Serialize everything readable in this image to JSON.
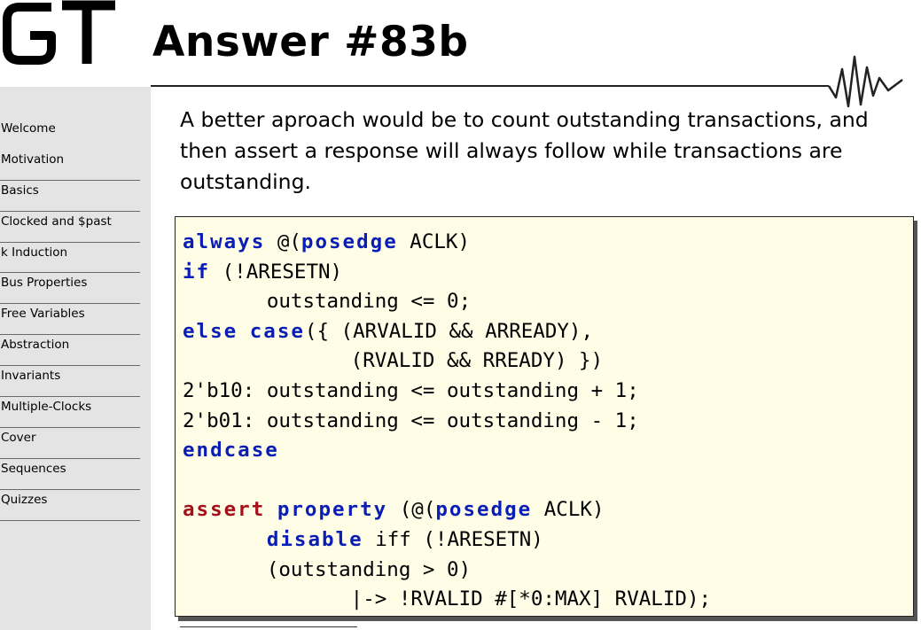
{
  "slide": {
    "logo_text": "GT",
    "title": "Answer #83b"
  },
  "sidebar": {
    "items": [
      {
        "label": "Welcome"
      },
      {
        "label": "Motivation"
      },
      {
        "label": "Basics"
      },
      {
        "label": "Clocked and $past"
      },
      {
        "label": "k Induction"
      },
      {
        "label": "Bus Properties"
      },
      {
        "label": "Free Variables"
      },
      {
        "label": "Abstraction"
      },
      {
        "label": "Invariants"
      },
      {
        "label": "Multiple-Clocks"
      },
      {
        "label": "Cover"
      },
      {
        "label": "Sequences"
      },
      {
        "label": "Quizzes"
      }
    ]
  },
  "body": {
    "intro": "A better aproach would be to count outstanding transactions, and then assert a response will always follow while transactions are outstanding."
  },
  "code": {
    "lines": [
      {
        "indent": "",
        "parts": [
          {
            "t": "always",
            "k": "kw"
          },
          {
            "t": " @("
          },
          {
            "t": "posedge",
            "k": "kw"
          },
          {
            "t": " ACLK)"
          }
        ]
      },
      {
        "indent": "",
        "parts": [
          {
            "t": "if",
            "k": "kw"
          },
          {
            "t": " (!ARESETN)"
          }
        ]
      },
      {
        "indent": "       ",
        "parts": [
          {
            "t": "outstanding <= 0;"
          }
        ]
      },
      {
        "indent": "",
        "parts": [
          {
            "t": "else",
            "k": "kw"
          },
          {
            "t": " "
          },
          {
            "t": "case",
            "k": "kw"
          },
          {
            "t": "({ (ARVALID && ARREADY),"
          }
        ]
      },
      {
        "indent": "              ",
        "parts": [
          {
            "t": "(RVALID && RREADY) })"
          }
        ]
      },
      {
        "indent": "",
        "parts": [
          {
            "t": "2'b10: outstanding <= outstanding + 1;"
          }
        ]
      },
      {
        "indent": "",
        "parts": [
          {
            "t": "2'b01: outstanding <= outstanding - 1;"
          }
        ]
      },
      {
        "indent": "",
        "parts": [
          {
            "t": "endcase",
            "k": "kw"
          }
        ]
      },
      {
        "indent": "",
        "parts": [
          {
            "t": ""
          }
        ]
      },
      {
        "indent": "",
        "parts": [
          {
            "t": "assert",
            "k": "kr"
          },
          {
            "t": " "
          },
          {
            "t": "property",
            "k": "kw"
          },
          {
            "t": " (@("
          },
          {
            "t": "posedge",
            "k": "kw"
          },
          {
            "t": " ACLK)"
          }
        ]
      },
      {
        "indent": "       ",
        "parts": [
          {
            "t": "disable",
            "k": "kw"
          },
          {
            "t": " iff (!ARESETN)"
          }
        ]
      },
      {
        "indent": "       ",
        "parts": [
          {
            "t": "(outstanding > 0)"
          }
        ]
      },
      {
        "indent": "              ",
        "parts": [
          {
            "t": "|-> !RVALID #[*0:MAX] RVALID);"
          }
        ]
      }
    ]
  }
}
